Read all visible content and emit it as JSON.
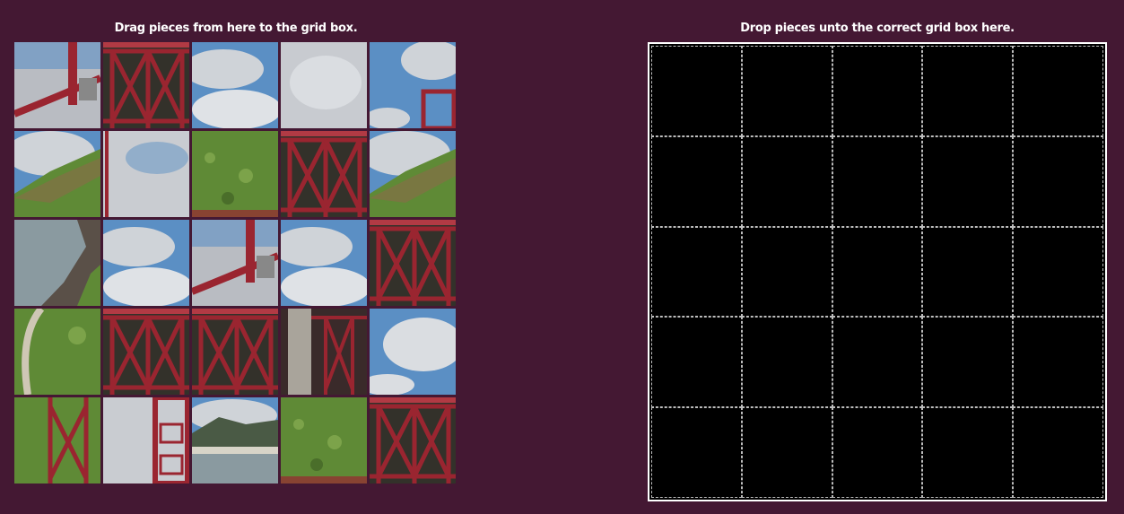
{
  "source": {
    "heading": "Drag pieces from here to the grid box."
  },
  "target": {
    "heading": "Drop pieces unto the correct grid box here.",
    "rows": 5,
    "cols": 5
  },
  "colors": {
    "background": "#441833",
    "bridge_red": "#9a2530",
    "sky_blue": "#5b8fc4",
    "cloud": "#cfd3d8",
    "hill_green": "#5f8a36",
    "water": "#8a9aa0",
    "drop_cell": "#000000"
  },
  "pieces": [
    {
      "name": "piece-1",
      "kind": "bridge-road"
    },
    {
      "name": "piece-2",
      "kind": "truss"
    },
    {
      "name": "piece-3",
      "kind": "sky"
    },
    {
      "name": "piece-4",
      "kind": "cloud"
    },
    {
      "name": "piece-5",
      "kind": "tower-sky"
    },
    {
      "name": "piece-6",
      "kind": "hill-sky"
    },
    {
      "name": "piece-7",
      "kind": "cloud-pole"
    },
    {
      "name": "piece-8",
      "kind": "green-hill"
    },
    {
      "name": "piece-9",
      "kind": "truss"
    },
    {
      "name": "piece-10",
      "kind": "hill-sky"
    },
    {
      "name": "piece-11",
      "kind": "water-shore"
    },
    {
      "name": "piece-12",
      "kind": "sky"
    },
    {
      "name": "piece-13",
      "kind": "bridge-road"
    },
    {
      "name": "piece-14",
      "kind": "sky"
    },
    {
      "name": "piece-15",
      "kind": "truss"
    },
    {
      "name": "piece-16",
      "kind": "path-hill"
    },
    {
      "name": "piece-17",
      "kind": "truss"
    },
    {
      "name": "piece-18",
      "kind": "truss"
    },
    {
      "name": "piece-19",
      "kind": "pillar-truss"
    },
    {
      "name": "piece-20",
      "kind": "cloud-sky"
    },
    {
      "name": "piece-21",
      "kind": "truss-green"
    },
    {
      "name": "piece-22",
      "kind": "tower-cloud"
    },
    {
      "name": "piece-23",
      "kind": "town-water"
    },
    {
      "name": "piece-24",
      "kind": "green-hill"
    },
    {
      "name": "piece-25",
      "kind": "truss"
    }
  ]
}
